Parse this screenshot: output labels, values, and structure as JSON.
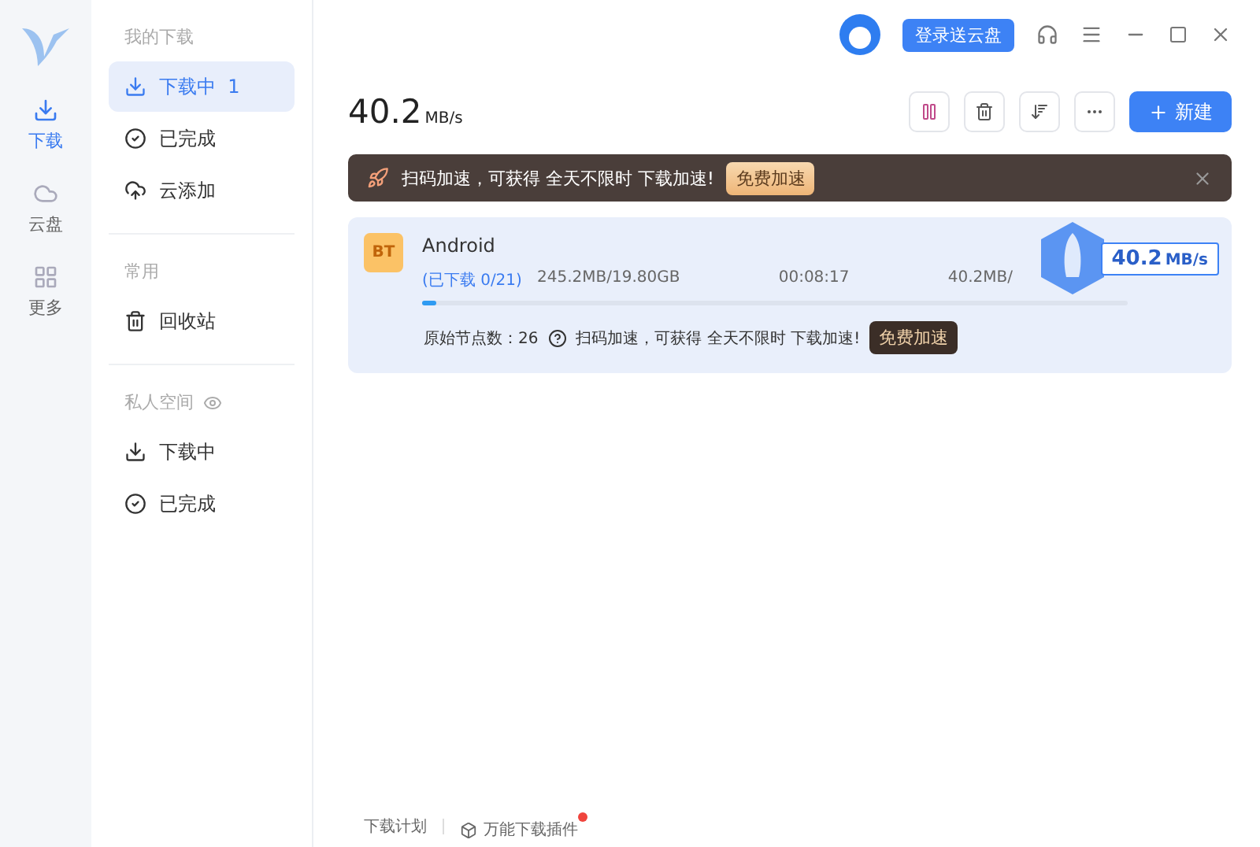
{
  "rail": [
    {
      "label": "下载",
      "selected": true
    },
    {
      "label": "云盘",
      "selected": false
    },
    {
      "label": "更多",
      "selected": false
    }
  ],
  "sidebar": {
    "sections": [
      {
        "title": "我的下载",
        "items": [
          {
            "label": "下载中",
            "count": "1",
            "selected": true
          },
          {
            "label": "已完成",
            "selected": false
          },
          {
            "label": "云添加",
            "selected": false
          }
        ]
      },
      {
        "title": "常用",
        "items": [
          {
            "label": "回收站",
            "selected": false
          }
        ]
      },
      {
        "title": "私人空间",
        "eye": true,
        "items": [
          {
            "label": "下载中",
            "selected": false
          },
          {
            "label": "已完成",
            "selected": false
          }
        ]
      }
    ]
  },
  "header": {
    "login_button": "登录送云盘"
  },
  "speed": {
    "value": "40.2",
    "unit": "MB/s"
  },
  "new_button": "新建",
  "banner": {
    "text": "扫码加速，可获得 全天不限时 下载加速!",
    "button": "免费加速"
  },
  "tasks": [
    {
      "name": "Android",
      "badge": "BT",
      "downloaded": "(已下载 0/21)",
      "size": "245.2MB/19.80GB",
      "time": "00:08:17",
      "speed": "40.2MB/",
      "level": 0.02,
      "nodes": "原始节点数：26",
      "promo": "扫码加速，可获得 全天不限时 下载加速!",
      "promo_button": "免费加速",
      "boost": {
        "value": "40.2",
        "unit": "MB/s"
      }
    }
  ],
  "footer": {
    "plan": "下载计划",
    "plugin": "万能下载插件",
    "plugin_dot": true
  }
}
